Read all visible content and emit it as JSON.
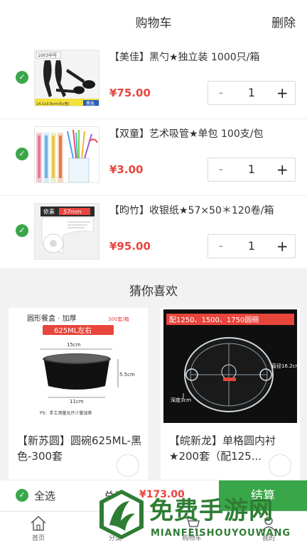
{
  "header": {
    "title": "购物车",
    "delete_label": "删除"
  },
  "cart": {
    "items": [
      {
        "name": "【美佳】黑勺★独立装 1000只/箱",
        "price": "¥75.00",
        "qty": "1",
        "image_text": {
          "tag": "1003中号",
          "size": "14.1x3.8cm(长x宽)",
          "color": "黑色"
        }
      },
      {
        "name": "【双童】艺术吸管★单包 100支/包",
        "price": "¥3.00",
        "qty": "1"
      },
      {
        "name": "【昀竹】收银纸★57×50＊120卷/箱",
        "price": "¥95.00",
        "qty": "1",
        "image_text": {
          "brand": "依素",
          "size": "57mm"
        }
      }
    ],
    "minus_symbol": "-",
    "plus_symbol": "+"
  },
  "recommend": {
    "title": "猜你喜欢",
    "cards": [
      {
        "name": "【新苏圆】圆碗625ML-黑色-300套",
        "image_text": {
          "header": "圆形餐盒 · 加厚",
          "header_count": "300套/箱",
          "volume": "625ML左右",
          "width_top": "15cm",
          "height": "5.5cm",
          "width_bottom": "11cm",
          "note": "PS：手工测量允许少量误差"
        }
      },
      {
        "name": "【皖新龙】单格圆内衬★200套（配125...",
        "image_text": {
          "header": "配1250、1500、1750圆碗",
          "diameter": "直径16.2cm",
          "depth": "深度3cm"
        }
      }
    ]
  },
  "summary": {
    "select_all_label": "全选",
    "total_label": "总计：",
    "total_value": "¥173.00",
    "checkout_label": "结算"
  },
  "tabbar": {
    "items": [
      {
        "label": "首页",
        "icon": "home-icon"
      },
      {
        "label": "分类",
        "icon": "category-icon"
      },
      {
        "label": "购物车",
        "icon": "cart-icon"
      },
      {
        "label": "我的",
        "icon": "user-icon"
      }
    ]
  },
  "watermark": {
    "title": "免费手游网",
    "subtitle": "MIANFEISHOUYOUWANG"
  },
  "colors": {
    "accent_green": "#3aa64a",
    "price_red": "#e8453c",
    "watermark_green": "#2f7d34"
  }
}
